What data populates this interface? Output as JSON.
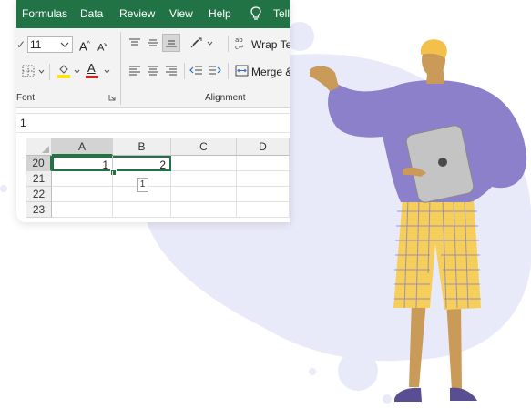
{
  "menu": {
    "items": [
      "Formulas",
      "Data",
      "Review",
      "View",
      "Help",
      "Tell"
    ]
  },
  "ribbon": {
    "font_size": "11",
    "wrap_text_label": "Wrap Te",
    "merge_label": "Merge &",
    "font_group_label": "Font",
    "alignment_group_label": "Alignment",
    "font_color_letter": "A",
    "grow_font_letter": "A",
    "shrink_font_letter": "A"
  },
  "formula_bar": {
    "value": "1"
  },
  "sheet": {
    "columns": [
      "A",
      "B",
      "C",
      "D"
    ],
    "rows": [
      "20",
      "21",
      "22",
      "23"
    ],
    "cells": {
      "A20": "1",
      "B20": "2"
    },
    "tooltip": "1"
  },
  "colors": {
    "excel_green": "#217346",
    "blob": "#e9eaf9",
    "sweater": "#8b80c9",
    "shorts": "#f5cf5a",
    "skin": "#c99a58",
    "hair": "#f3c04a",
    "shoes": "#5a4e92",
    "tablet": "#c4c4c4"
  }
}
